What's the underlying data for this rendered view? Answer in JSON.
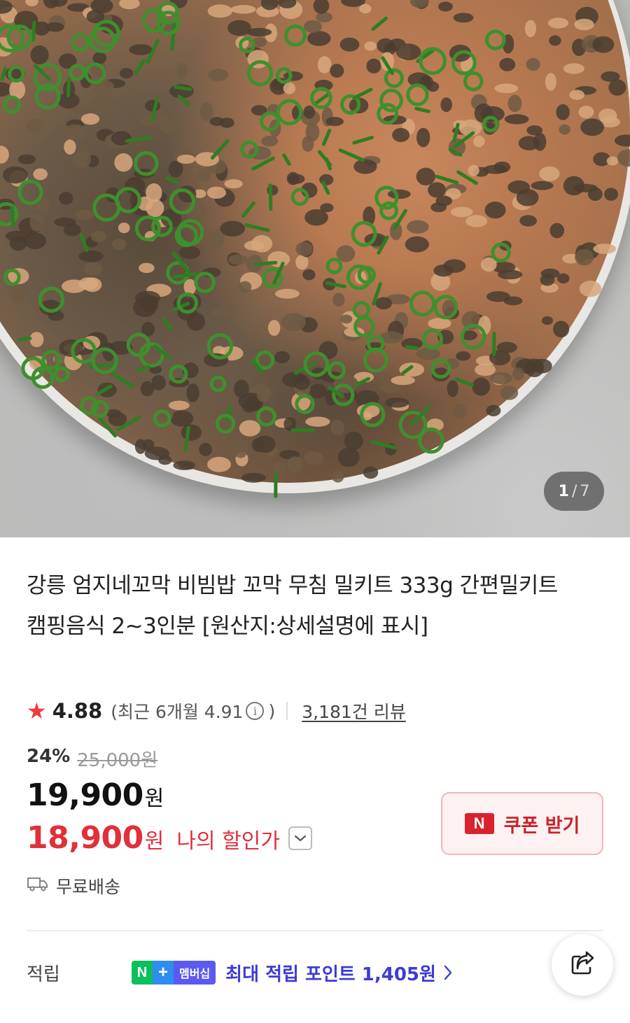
{
  "gallery": {
    "current": "1",
    "separator": "/",
    "total": "7"
  },
  "product": {
    "title": "강릉 엄지네꼬막 비빔밥 꼬막 무침 밀키트 333g 간편밀키트 캠핑음식 2~3인분 [원산지:상세설명에 표시]"
  },
  "rating": {
    "star_icon": "star-icon",
    "score": "4.88",
    "recent_text": "(최근 6개월 4.91",
    "recent_close": ")",
    "info_icon": "info-icon",
    "review_count": "3,181건 리뷰"
  },
  "pricing": {
    "discount_rate": "24%",
    "original_price": "25,000원",
    "sale_price": "19,900",
    "sale_unit": "원",
    "my_price": "18,900",
    "my_price_unit": "원",
    "my_price_label": "나의 할인가",
    "accent_color": "#e0303a"
  },
  "coupon": {
    "badge": "N",
    "label": "쿠폰 받기"
  },
  "shipping": {
    "icon": "truck-icon",
    "label": "무료배송"
  },
  "points": {
    "label": "적립",
    "badge_n": "N",
    "badge_plus": "+",
    "badge_text": "멤버십",
    "text": "최대 적립 포인트 1,405원"
  },
  "share": {
    "icon": "share-icon"
  }
}
